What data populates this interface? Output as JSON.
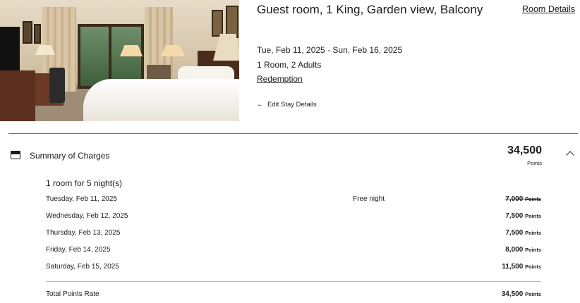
{
  "room": {
    "title": "Guest room, 1 King, Garden view, Balcony",
    "room_details_label": "Room Details",
    "dates": "Tue, Feb 11, 2025 - Sun, Feb 16, 2025",
    "guests": "1 Room, 2 Adults",
    "rate_type": "Redemption",
    "edit_stay_label": "Edit Stay Details"
  },
  "summary": {
    "label": "Summary of Charges",
    "total": "34,500",
    "total_unit": "Points",
    "rooms_nights": "1 room for 5 night(s)",
    "nights": [
      {
        "date": "Tuesday, Feb 11, 2025",
        "note": "Free night",
        "amount": "7,000",
        "unit": "Points",
        "struck": true
      },
      {
        "date": "Wednesday, Feb 12, 2025",
        "note": "",
        "amount": "7,500",
        "unit": "Points",
        "struck": false
      },
      {
        "date": "Thursday, Feb 13, 2025",
        "note": "",
        "amount": "7,500",
        "unit": "Points",
        "struck": false
      },
      {
        "date": "Friday, Feb 14, 2025",
        "note": "",
        "amount": "8,000",
        "unit": "Points",
        "struck": false
      },
      {
        "date": "Saturday, Feb 15, 2025",
        "note": "",
        "amount": "11,500",
        "unit": "Points",
        "struck": false
      }
    ],
    "total_row_label": "Total Points Rate",
    "total_row_amount": "34,500",
    "total_row_unit": "Points"
  },
  "icons": {
    "summary": "receipt-icon",
    "collapse": "chevron-up-icon",
    "back": "arrow-left-icon"
  }
}
